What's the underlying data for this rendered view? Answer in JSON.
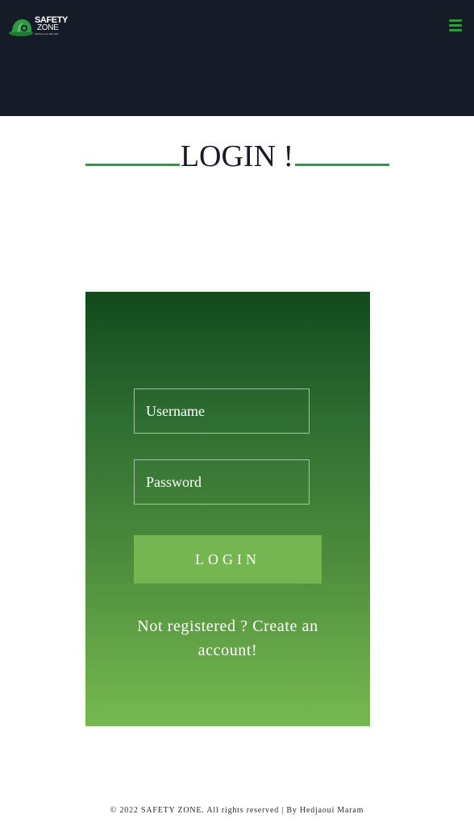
{
  "brand": {
    "name_line1": "SAFETY",
    "name_line2": "ZONE",
    "tagline": "behave your safe safe",
    "colors": {
      "header_bg": "#161c27",
      "accent_green": "#2e9a42",
      "card_top": "#104a1d",
      "card_bottom": "#77b950",
      "button": "#76b652"
    }
  },
  "header": {
    "menu_icon": "hamburger-menu-icon"
  },
  "page": {
    "title": "LOGIN !"
  },
  "form": {
    "username_placeholder": "Username",
    "password_placeholder": "Password",
    "submit_label": "LOGIN",
    "register_text": "Not registered ? Create an account!"
  },
  "footer": {
    "text": "© 2022 SAFETY ZONE. All rights reserved | By Hedjaoui Maram"
  }
}
